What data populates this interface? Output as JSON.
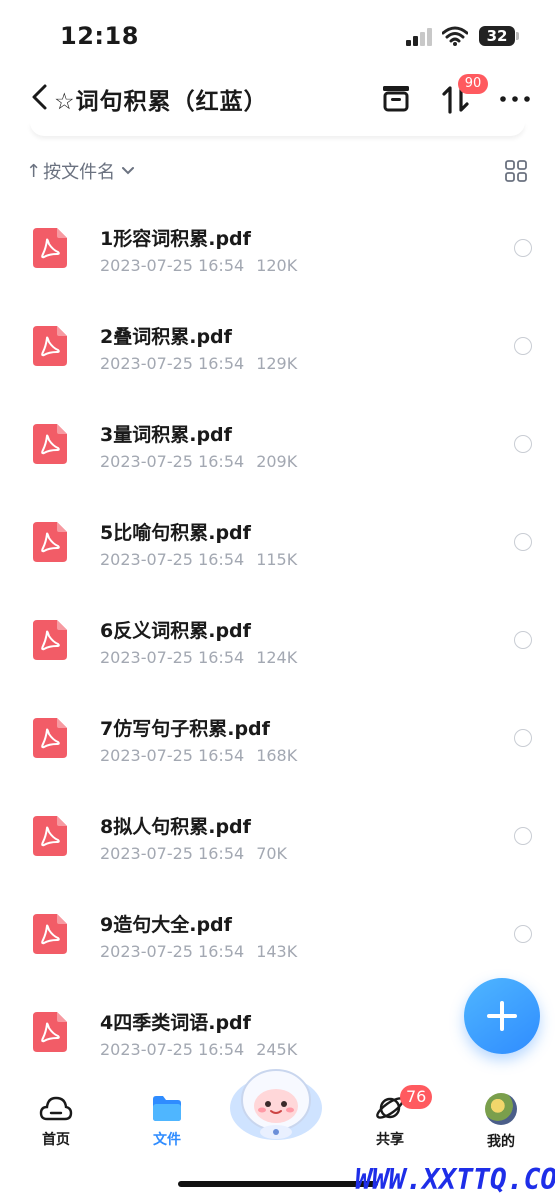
{
  "status_bar": {
    "time": "12:18",
    "battery": "32",
    "icons": [
      "cellular-signal-icon",
      "wifi-icon",
      "battery-icon"
    ]
  },
  "header": {
    "title": "☆词句积累（红蓝）",
    "transfer_badge": "90",
    "icons": [
      "back-chevron-icon",
      "archive-icon",
      "transfer-arrows-icon",
      "more-dots-icon"
    ]
  },
  "sort_bar": {
    "label": "按文件名",
    "arrow": "↑",
    "icons": [
      "chevron-down-icon",
      "grid-view-icon"
    ]
  },
  "files": [
    {
      "name": "1形容词积累.pdf",
      "date": "2023-07-25 16:54",
      "size": "120K"
    },
    {
      "name": "2叠词积累.pdf",
      "date": "2023-07-25 16:54",
      "size": "129K"
    },
    {
      "name": "3量词积累.pdf",
      "date": "2023-07-25 16:54",
      "size": "209K"
    },
    {
      "name": "5比喻句积累.pdf",
      "date": "2023-07-25 16:54",
      "size": "115K"
    },
    {
      "name": "6反义词积累.pdf",
      "date": "2023-07-25 16:54",
      "size": "124K"
    },
    {
      "name": "7仿写句子积累.pdf",
      "date": "2023-07-25 16:54",
      "size": "168K"
    },
    {
      "name": "8拟人句积累.pdf",
      "date": "2023-07-25 16:54",
      "size": "70K"
    },
    {
      "name": "9造句大全.pdf",
      "date": "2023-07-25 16:54",
      "size": "143K"
    },
    {
      "name": "4四季类词语.pdf",
      "date": "2023-07-25 16:54",
      "size": "245K"
    }
  ],
  "nav": {
    "home": "首页",
    "files": "文件",
    "share": "共享",
    "share_badge": "76",
    "me": "我的",
    "active": "files"
  },
  "watermark": "WWW.XXTTQ.COM",
  "colors": {
    "accent": "#2f8cff",
    "badge": "#ff5a5f",
    "pdf": "#f25c67",
    "meta_text": "#a3a8b2"
  }
}
